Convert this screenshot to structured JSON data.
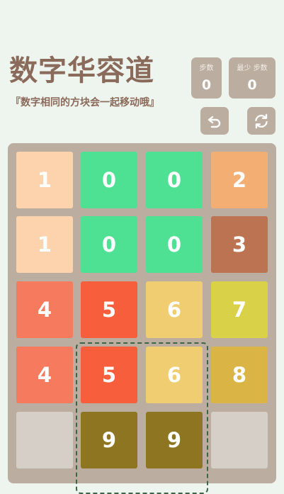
{
  "app": {
    "title": "数字华容道",
    "subtitle": "『数字相同的方块会一起移动哦』"
  },
  "score": {
    "steps_label": "步数",
    "steps_value": "0",
    "best_label": "最少 步数",
    "best_value": "0"
  },
  "buttons": {
    "undo_icon": "undo-icon",
    "reset_icon": "refresh-icon"
  },
  "board": {
    "rows": [
      [
        {
          "value": "1",
          "color": "#fcd3ad"
        },
        {
          "value": "0",
          "color": "#4fe193"
        },
        {
          "value": "0",
          "color": "#4fe193"
        },
        {
          "value": "2",
          "color": "#f3ae74"
        }
      ],
      [
        {
          "value": "1",
          "color": "#fcd3ad"
        },
        {
          "value": "0",
          "color": "#4fe193"
        },
        {
          "value": "0",
          "color": "#4fe193"
        },
        {
          "value": "3",
          "color": "#bb7351"
        }
      ],
      [
        {
          "value": "4",
          "color": "#f67a5d"
        },
        {
          "value": "5",
          "color": "#f75e3b"
        },
        {
          "value": "6",
          "color": "#f0cd71"
        },
        {
          "value": "7",
          "color": "#d9d147"
        }
      ],
      [
        {
          "value": "4",
          "color": "#f67a5d"
        },
        {
          "value": "5",
          "color": "#f75e3b"
        },
        {
          "value": "6",
          "color": "#f0cd71"
        },
        {
          "value": "8",
          "color": "#dab546"
        }
      ],
      [
        {
          "value": "",
          "color": "#d6cfc8"
        },
        {
          "value": "9",
          "color": "#8e7522"
        },
        {
          "value": "9",
          "color": "#8e7522"
        },
        {
          "value": "",
          "color": "#d6cfc8"
        }
      ]
    ],
    "selected_piece": "5-6-9 block",
    "selection_color": "#3d6448"
  }
}
